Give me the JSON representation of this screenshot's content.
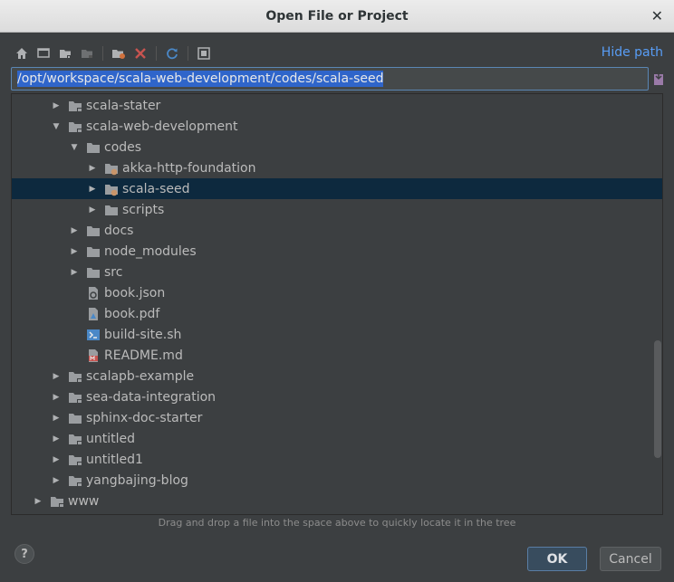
{
  "window": {
    "title": "Open File or Project",
    "close_glyph": "✕"
  },
  "toolbar": {
    "icons": [
      "home-icon",
      "desktop-icon",
      "folder-icon",
      "project-folder-icon",
      "new-folder-icon",
      "delete-icon",
      "refresh-icon",
      "show-hidden-icon"
    ]
  },
  "hide_path_label": "Hide path",
  "path": {
    "value": "/opt/workspace/scala-web-development/codes/scala-seed"
  },
  "tree": {
    "rows": [
      {
        "label": "scala-stater",
        "depth": 3,
        "arrow": "right",
        "icon": "folder-module"
      },
      {
        "label": "scala-web-development",
        "depth": 3,
        "arrow": "down",
        "icon": "folder-module"
      },
      {
        "label": "codes",
        "depth": 4,
        "arrow": "down",
        "icon": "folder"
      },
      {
        "label": "akka-http-foundation",
        "depth": 5,
        "arrow": "right",
        "icon": "folder-sbt"
      },
      {
        "label": "scala-seed",
        "depth": 5,
        "arrow": "right",
        "icon": "folder-sbt",
        "selected": true
      },
      {
        "label": "scripts",
        "depth": 5,
        "arrow": "right",
        "icon": "folder"
      },
      {
        "label": "docs",
        "depth": 4,
        "arrow": "right",
        "icon": "folder"
      },
      {
        "label": "node_modules",
        "depth": 4,
        "arrow": "right",
        "icon": "folder"
      },
      {
        "label": "src",
        "depth": 4,
        "arrow": "right",
        "icon": "folder"
      },
      {
        "label": "book.json",
        "depth": 4,
        "arrow": "none",
        "icon": "json-file"
      },
      {
        "label": "book.pdf",
        "depth": 4,
        "arrow": "none",
        "icon": "pdf-file"
      },
      {
        "label": "build-site.sh",
        "depth": 4,
        "arrow": "none",
        "icon": "shell-file"
      },
      {
        "label": "README.md",
        "depth": 4,
        "arrow": "none",
        "icon": "markdown-file"
      },
      {
        "label": "scalapb-example",
        "depth": 3,
        "arrow": "right",
        "icon": "folder-module"
      },
      {
        "label": "sea-data-integration",
        "depth": 3,
        "arrow": "right",
        "icon": "folder-module"
      },
      {
        "label": "sphinx-doc-starter",
        "depth": 3,
        "arrow": "right",
        "icon": "folder"
      },
      {
        "label": "untitled",
        "depth": 3,
        "arrow": "right",
        "icon": "folder-module"
      },
      {
        "label": "untitled1",
        "depth": 3,
        "arrow": "right",
        "icon": "folder-module"
      },
      {
        "label": "yangbajing-blog",
        "depth": 3,
        "arrow": "right",
        "icon": "folder-module"
      },
      {
        "label": "www",
        "depth": 2,
        "arrow": "right",
        "icon": "folder-module"
      }
    ]
  },
  "hint": "Drag and drop a file into the space above to quickly locate it in the tree",
  "help_glyph": "?",
  "buttons": {
    "ok": "OK",
    "cancel": "Cancel"
  },
  "colors": {
    "background": "#3c3f41",
    "selection": "#0d293e",
    "link": "#589df6",
    "folder": "#9a9da0"
  }
}
